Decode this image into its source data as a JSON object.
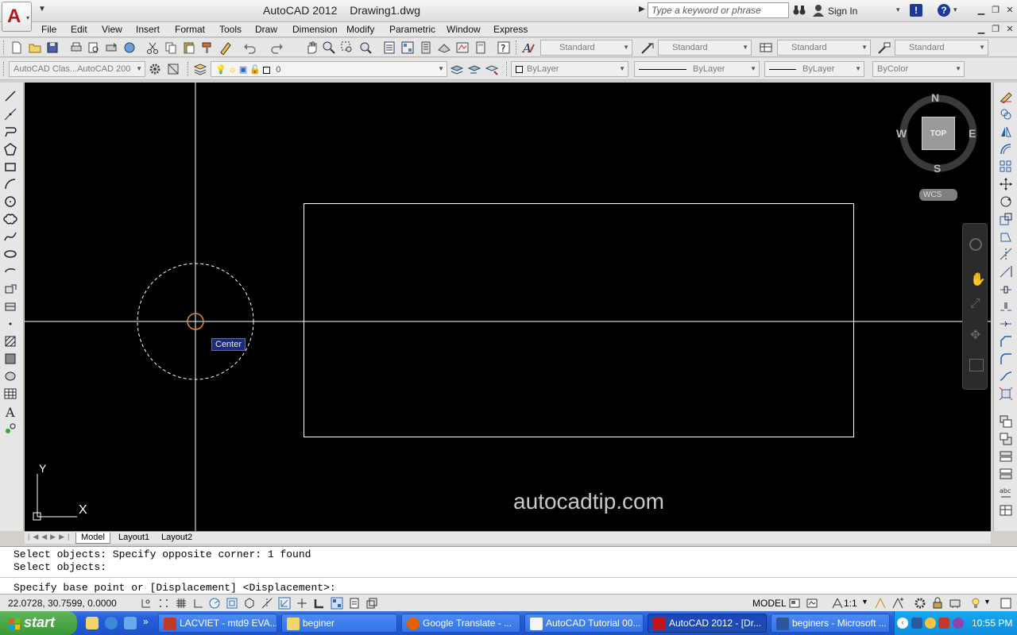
{
  "window": {
    "app_title": "AutoCAD 2012",
    "doc_title": "Drawing1.dwg",
    "search_placeholder": "Type a keyword or phrase",
    "sign_in": "Sign In"
  },
  "menu": [
    "File",
    "Edit",
    "View",
    "Insert",
    "Format",
    "Tools",
    "Draw",
    "Dimension",
    "Modify",
    "Parametric",
    "Window",
    "Express"
  ],
  "styles_toolbar": {
    "text_style": "Standard",
    "dim_style": "Standard",
    "table_style": "Standard",
    "mleader_style": "Standard"
  },
  "layers_toolbar": {
    "workspace": "AutoCAD Clas...AutoCAD 200",
    "layer_value": "0",
    "color": "ByLayer",
    "linetype": "ByLayer",
    "lineweight": "ByLayer",
    "plotstyle": "ByColor"
  },
  "viewcube": {
    "north": "N",
    "south": "S",
    "east": "E",
    "west": "W",
    "face": "TOP",
    "ucs": "WCS"
  },
  "canvas": {
    "snap_tooltip": "Center",
    "watermark": "autocadtip.com",
    "ucs_x": "X",
    "ucs_y": "Y"
  },
  "tabs": [
    "Model",
    "Layout1",
    "Layout2"
  ],
  "command": {
    "history_1": "Select objects: Specify opposite corner: 1 found",
    "history_2": "Select objects:",
    "prompt": "Specify base point or [Displacement] <Displacement>:"
  },
  "status": {
    "coords": "22.0728, 30.7599, 0.0000",
    "space": "MODEL",
    "annotation_scale": "1:1"
  },
  "taskbar": {
    "start": "start",
    "tasks": [
      {
        "label": "LACVIET - mtd9 EVA...",
        "active": false
      },
      {
        "label": "beginer",
        "active": false
      },
      {
        "label": "Google Translate - ...",
        "active": false
      },
      {
        "label": "AutoCAD Tutorial 00...",
        "active": false
      },
      {
        "label": "AutoCAD 2012 - [Dr...",
        "active": true
      },
      {
        "label": "beginers - Microsoft ...",
        "active": false
      }
    ],
    "clock": "10:55 PM"
  },
  "colors": {
    "canvas_bg": "#000000",
    "snap_marker": "#e08a30",
    "taskbar_blue": "#245edb",
    "start_green": "#3b9a37"
  }
}
